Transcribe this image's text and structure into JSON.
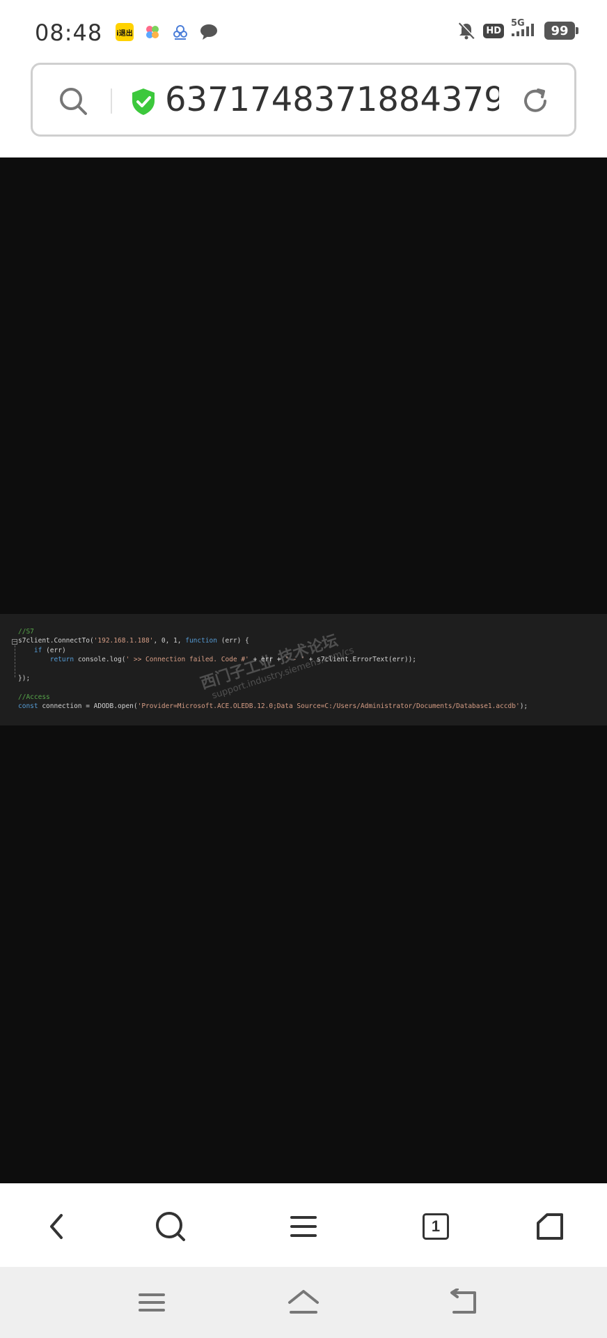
{
  "status_bar": {
    "time": "08:48",
    "notification_icons": [
      "app-badge-icon",
      "flower-app-icon",
      "cloud-app-icon",
      "chat-bubble-icon"
    ],
    "app_badge_text": "i退出",
    "hd_label": "HD",
    "network_label": "5G",
    "battery_level": "99"
  },
  "address_bar": {
    "url": "6371748371884379···",
    "secure_color": "#3cc83c"
  },
  "code_image": {
    "lines": [
      {
        "type": "comment",
        "text": "//S7"
      },
      {
        "type": "mixed",
        "parts": [
          {
            "cls": "",
            "text": "s7client.ConnectTo("
          },
          {
            "cls": "c-string",
            "text": "'192.168.1.188'"
          },
          {
            "cls": "",
            "text": ", 0, 1, "
          },
          {
            "cls": "c-keyword",
            "text": "function"
          },
          {
            "cls": "",
            "text": " (err) {"
          }
        ]
      },
      {
        "type": "mixed",
        "parts": [
          {
            "cls": "",
            "text": "    "
          },
          {
            "cls": "c-keyword",
            "text": "if"
          },
          {
            "cls": "",
            "text": " (err)"
          }
        ]
      },
      {
        "type": "mixed",
        "parts": [
          {
            "cls": "",
            "text": "        "
          },
          {
            "cls": "c-keyword",
            "text": "return"
          },
          {
            "cls": "",
            "text": " console.log("
          },
          {
            "cls": "c-string",
            "text": "' >> Connection failed. Code #'"
          },
          {
            "cls": "",
            "text": " + err + "
          },
          {
            "cls": "c-string",
            "text": "' - '"
          },
          {
            "cls": "",
            "text": " + s7client.ErrorText(err));"
          }
        ]
      },
      {
        "type": "plain",
        "text": ""
      },
      {
        "type": "plain",
        "text": "});"
      },
      {
        "type": "plain",
        "text": ""
      },
      {
        "type": "comment",
        "text": "//Access"
      },
      {
        "type": "mixed",
        "parts": [
          {
            "cls": "c-keyword",
            "text": "const"
          },
          {
            "cls": "",
            "text": " connection = ADODB.open("
          },
          {
            "cls": "c-string",
            "text": "'Provider=Microsoft.ACE.OLEDB.12.0;Data Source=C:/Users/Administrator/Documents/Database1.accdb'"
          },
          {
            "cls": "",
            "text": ");"
          }
        ]
      }
    ],
    "fold_marker": "−",
    "watermark_cn": "西门子工业 技术论坛",
    "watermark_en": "support.industry.siemens.com/cs"
  },
  "toolbar": {
    "tab_count": "1"
  },
  "icons": {
    "back": "back-arrow-icon",
    "search": "search-icon",
    "menu": "menu-icon",
    "tabs": "tabs-icon",
    "home": "home-icon"
  }
}
